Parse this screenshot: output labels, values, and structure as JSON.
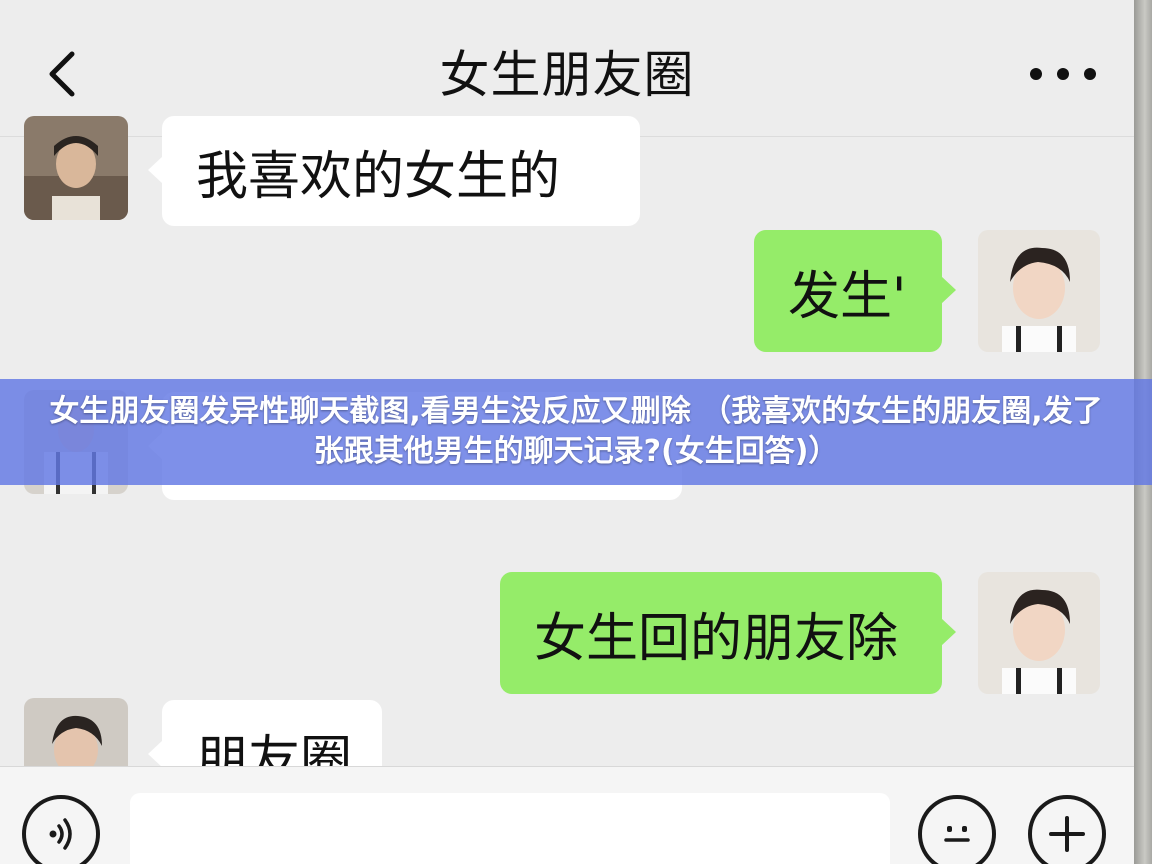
{
  "header": {
    "title": "女生朋友圈"
  },
  "messages": [
    {
      "side": "left",
      "text": "我喜欢的女生的"
    },
    {
      "side": "right",
      "text": "发生'"
    },
    {
      "side": "left",
      "text": ""
    },
    {
      "side": "right",
      "text": "女生回的朋友除"
    },
    {
      "side": "left",
      "text": "朋友圈"
    }
  ],
  "banner": {
    "text": "女生朋友圈发异性聊天截图,看男生没反应又删除 （我喜欢的女生的朋友圈,发了张跟其他男生的聊天记录?(女生回答)）"
  },
  "icons": {
    "back": "chevron-left-icon",
    "more": "more-dots-icon",
    "voice": "voice-icon",
    "emoji": "emoji-icon",
    "add": "plus-icon"
  },
  "colors": {
    "incoming_bubble": "#ffffff",
    "outgoing_bubble": "#95ec69",
    "chat_background": "#ededed",
    "banner": "#6278e4"
  }
}
